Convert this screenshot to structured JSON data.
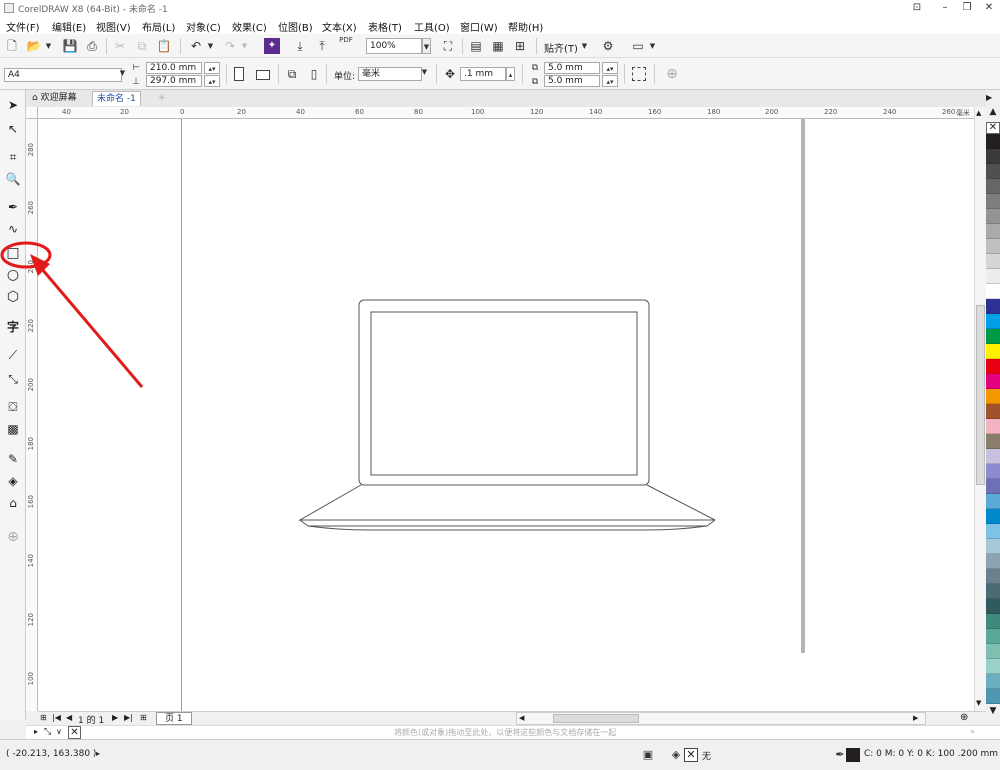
{
  "title_bar": {
    "title": "CorelDRAW X8 (64-Bit) - 未命名 -1"
  },
  "menu": [
    "文件(F)",
    "编辑(E)",
    "视图(V)",
    "布局(L)",
    "对象(C)",
    "效果(C)",
    "位图(B)",
    "文本(X)",
    "表格(T)",
    "工具(O)",
    "窗口(W)",
    "帮助(H)"
  ],
  "toolbar": {
    "zoom": "100%",
    "snap_label": "贴齐(T)",
    "pdf_label": "PDF"
  },
  "property_bar": {
    "page_size": "A4",
    "width": "210.0 mm",
    "height": "297.0 mm",
    "units_label": "单位:",
    "units_value": "毫米",
    "nudge": ".1 mm",
    "dup_x": "5.0 mm",
    "dup_y": "5.0 mm"
  },
  "tabs": {
    "welcome": "欢迎屏幕",
    "document": "未命名 -1"
  },
  "rulers": {
    "h_labels": [
      "40",
      "20",
      "0",
      "20",
      "40",
      "60",
      "80",
      "100",
      "120",
      "140",
      "160",
      "180",
      "200",
      "220",
      "240",
      "260"
    ],
    "h_unit": "毫米",
    "v_labels": [
      "280",
      "260",
      "240",
      "220",
      "200",
      "180",
      "160",
      "140",
      "120",
      "100"
    ]
  },
  "page_nav": {
    "of_label": "1 的 1",
    "page_tab": "页 1"
  },
  "hint": "将颜色(或对象)拖动至此处，以便将这些颜色与文档存储在一起",
  "status": {
    "coordinates": "( -20.213, 163.380 )",
    "fill_label": "无",
    "outline_info": "C: 0 M: 0 Y: 0 K: 100  .200 mm"
  },
  "palette_colors": [
    "#231f20",
    "#3a3a3a",
    "#505050",
    "#666666",
    "#7d7d7d",
    "#939393",
    "#aaaaaa",
    "#c0c0c0",
    "#d6d6d6",
    "#ececec",
    "#ffffff",
    "#2e3192",
    "#00a0e9",
    "#009944",
    "#fff100",
    "#e60012",
    "#e4007f",
    "#f39800",
    "#a0522d",
    "#f4b3c2",
    "#8a7d6b",
    "#c9c0e0",
    "#8e8ccf",
    "#6f6fb5",
    "#5aa9d6",
    "#0088cc",
    "#7dc3e8",
    "#a6c8d8",
    "#8ca3b3",
    "#6b7f8c",
    "#4d6a73",
    "#2f5a5e",
    "#3e8a7c",
    "#5aa898",
    "#7fbfb0",
    "#9ad1c9",
    "#6aaec0",
    "#4f97b3"
  ]
}
